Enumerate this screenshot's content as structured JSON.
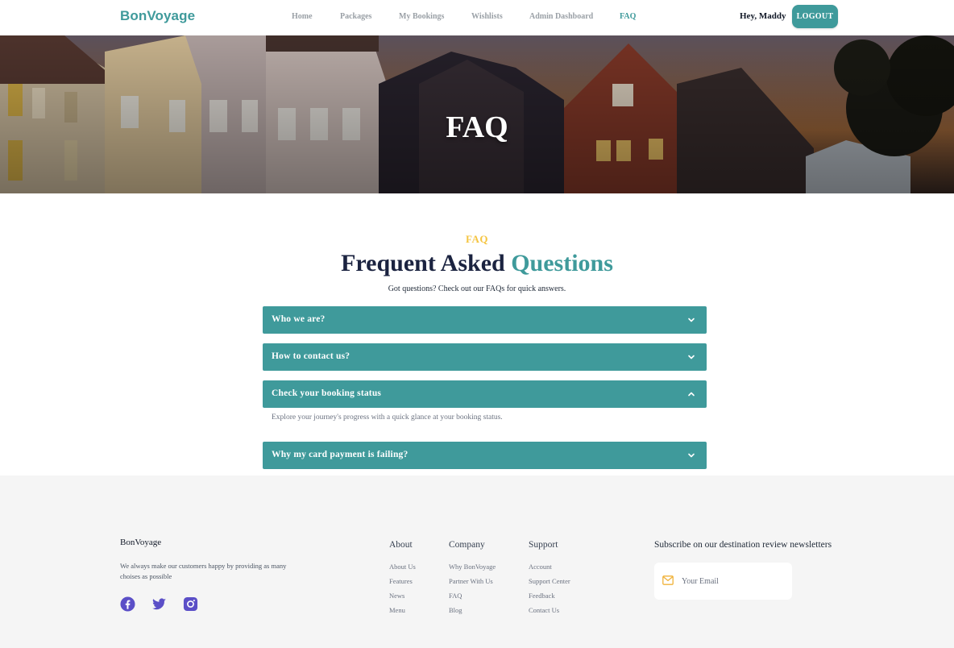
{
  "nav": {
    "brand": "BonVoyage",
    "links": [
      "Home",
      "Packages",
      "My Bookings",
      "Wishlists",
      "Admin Dashboard",
      "FAQ"
    ],
    "active": "FAQ",
    "greeting": "Hey, Maddy",
    "logout_label": "LOGOUT"
  },
  "hero": {
    "title": "FAQ"
  },
  "faq": {
    "eyebrow": "FAQ",
    "heading_main": "Frequent Asked",
    "heading_accent": "Questions",
    "subtitle": "Got questions? Check out our FAQs for quick answers.",
    "items": [
      {
        "question": "Who we are?",
        "expanded": false
      },
      {
        "question": "How to contact us?",
        "expanded": false
      },
      {
        "question": "Check your booking status",
        "expanded": true,
        "answer": "Explore your journey's progress with a quick glance at your booking status."
      },
      {
        "question": "Why my card payment is failing?",
        "expanded": false
      }
    ]
  },
  "footer": {
    "brand": "BonVoyage",
    "description": "We always make our customers happy by providing as many choises as possible",
    "social": [
      "facebook-icon",
      "twitter-icon",
      "instagram-icon"
    ],
    "columns": [
      {
        "title": "About",
        "links": [
          "About Us",
          "Features",
          "News",
          "Menu"
        ]
      },
      {
        "title": "Company",
        "links": [
          "Why BonVoyage",
          "Partner With Us",
          "FAQ",
          "Blog"
        ]
      },
      {
        "title": "Support",
        "links": [
          "Account",
          "Support Center",
          "Feedback",
          "Contact Us"
        ]
      }
    ],
    "newsletter_title": "Subscribe on our destination review newsletters",
    "email_placeholder": "Your Email"
  },
  "colors": {
    "accent": "#3f9a9b",
    "eyebrow": "#f5c542",
    "heading": "#1b2340",
    "social": "#5b4fc7",
    "footer_bg": "#f5f5f5"
  }
}
